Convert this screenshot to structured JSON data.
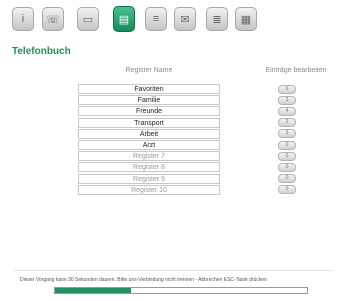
{
  "toolbar": {
    "icons": [
      {
        "name": "info-icon",
        "glyph": "i",
        "active": false
      },
      {
        "name": "telephone-icon",
        "glyph": "☏",
        "active": false
      },
      {
        "name": "answering-machine-icon",
        "glyph": "▭",
        "active": false
      },
      {
        "name": "phonebook-icon",
        "glyph": "▤",
        "active": true
      },
      {
        "name": "call-list-icon",
        "glyph": "≡",
        "active": false
      },
      {
        "name": "messages-icon",
        "glyph": "✉",
        "active": false
      },
      {
        "name": "settings-icon",
        "glyph": "≣",
        "active": false
      },
      {
        "name": "system-icon",
        "glyph": "▦",
        "active": false
      }
    ]
  },
  "section": {
    "title": "Telefonbuch"
  },
  "table": {
    "col_name": "Register Name",
    "col_edit": "Einträge bearbeiten",
    "rows": [
      {
        "name": "Favoriten",
        "dim": false,
        "edit_label": "6"
      },
      {
        "name": "Familie",
        "dim": false,
        "edit_label": "3"
      },
      {
        "name": "Freunde",
        "dim": false,
        "edit_label": "4"
      },
      {
        "name": "Transport",
        "dim": false,
        "edit_label": "2"
      },
      {
        "name": "Arbeit",
        "dim": false,
        "edit_label": "3"
      },
      {
        "name": "Arzt",
        "dim": false,
        "edit_label": "0"
      },
      {
        "name": "Register 7",
        "dim": true,
        "edit_label": "0"
      },
      {
        "name": "Register 8",
        "dim": true,
        "edit_label": "0"
      },
      {
        "name": "Register 9",
        "dim": true,
        "edit_label": "0"
      },
      {
        "name": "Register 10",
        "dim": true,
        "edit_label": "0"
      }
    ]
  },
  "status": {
    "text": "Dieser Vorgang kann 30 Sekunden dauern. Bitte uns-Verbindung nicht trennen - Abbrechen ESC-Taste drücken",
    "progress": 0.3
  }
}
